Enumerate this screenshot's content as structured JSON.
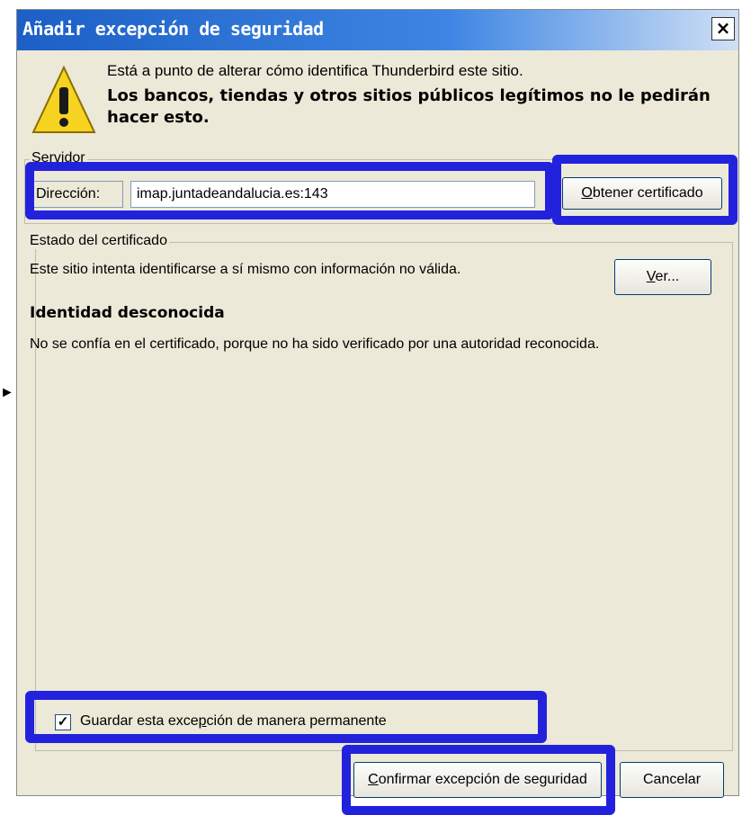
{
  "dialog": {
    "title": "Añadir excepción de seguridad",
    "close_symbol": "×"
  },
  "warning": {
    "icon": "warning-triangle-icon",
    "intro": "Está a punto de alterar cómo identifica Thunderbird este sitio.",
    "bold": "Los bancos, tiendas y otros sitios públicos legítimos no le pedirán hacer esto."
  },
  "server": {
    "legend": "Servidor",
    "address_label": "Dirección:",
    "address_value": "imap.juntadeandalucia.es:143",
    "get_cert_prefix": "O",
    "get_cert_rest": "btener certificado"
  },
  "cert_status": {
    "legend": "Estado del certificado",
    "message": "Este sitio intenta identificarse a sí mismo con información no válida.",
    "view_prefix": "V",
    "view_rest": "er...",
    "identity_heading": "Identidad desconocida",
    "identity_desc": "No se confía en el certificado, porque no ha sido verificado por una autoridad reconocida."
  },
  "permanent": {
    "checked": true,
    "check_mark": "✓",
    "label_before": "Guardar esta exce",
    "label_access": "p",
    "label_after": "ción de manera permanente"
  },
  "buttons": {
    "confirm_prefix": "C",
    "confirm_rest": "onfirmar excepción de seguridad",
    "cancel": "Cancelar"
  },
  "annotation": {
    "highlight_color": "#2222dd",
    "arrow": "►"
  }
}
